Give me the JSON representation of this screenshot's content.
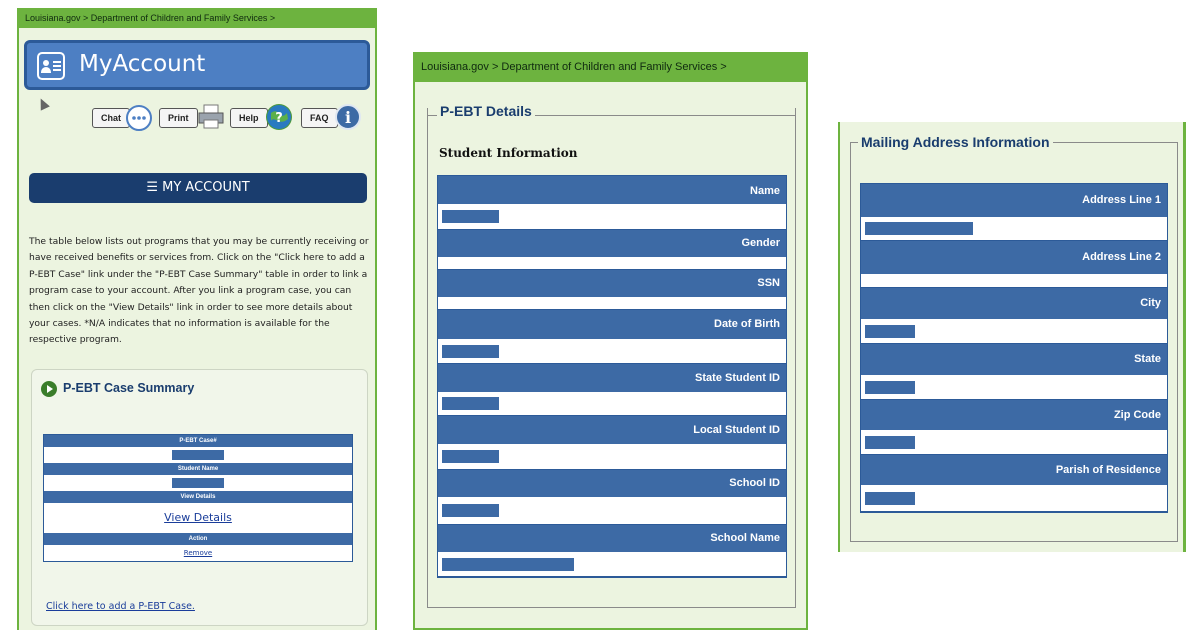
{
  "panel1": {
    "breadcrumb": "Louisiana.gov >  Department of Children and Family Services >",
    "title": "MyAccount",
    "toolbar": {
      "chat": "Chat",
      "print": "Print",
      "help": "Help",
      "faq": "FAQ"
    },
    "menu": "☰ MY ACCOUNT",
    "intro": "The table below lists out programs that you may be currently receiving or have received benefits or services from. Click on the \"Click here to add a P-EBT Case\" link under the \"P-EBT Case Summary\" table in order to link a program case to your account. After you link a program case, you can then click on the \"View Details\" link in order to see more details about your cases. *N/A indicates that no information is available for the respective program.",
    "summary_title": "P-EBT Case Summary",
    "case_table": {
      "h_case": "P-EBT Case#",
      "h_student": "Student Name",
      "h_details": "View Details",
      "details_link": "View Details",
      "h_action": "Action",
      "remove_link": "Remove"
    },
    "add_link": "Click here to add a P-EBT Case."
  },
  "panel2": {
    "breadcrumb": "Louisiana.gov >  Department of Children and Family Services >",
    "legend": "P-EBT Details",
    "section": "Student Information",
    "fields": [
      "Name",
      "Gender",
      "SSN",
      "Date of Birth",
      "State Student ID",
      "Local Student ID",
      "School ID",
      "School Name"
    ]
  },
  "panel3": {
    "legend": "Mailing Address Information",
    "fields": [
      "Address Line 1",
      "Address Line 2",
      "City",
      "State",
      "Zip Code",
      "Parish of Residence"
    ]
  },
  "colors": {
    "green": "#6db33f",
    "navy": "#1a3d6e",
    "header_blue": "#3d6aa5",
    "panel_bg": "#ecf4e0"
  },
  "icons": [
    "id-card-icon",
    "chat-bubble-icon",
    "printer-icon",
    "help-globe-icon",
    "info-icon",
    "play-icon",
    "mouse-cursor-icon"
  ]
}
